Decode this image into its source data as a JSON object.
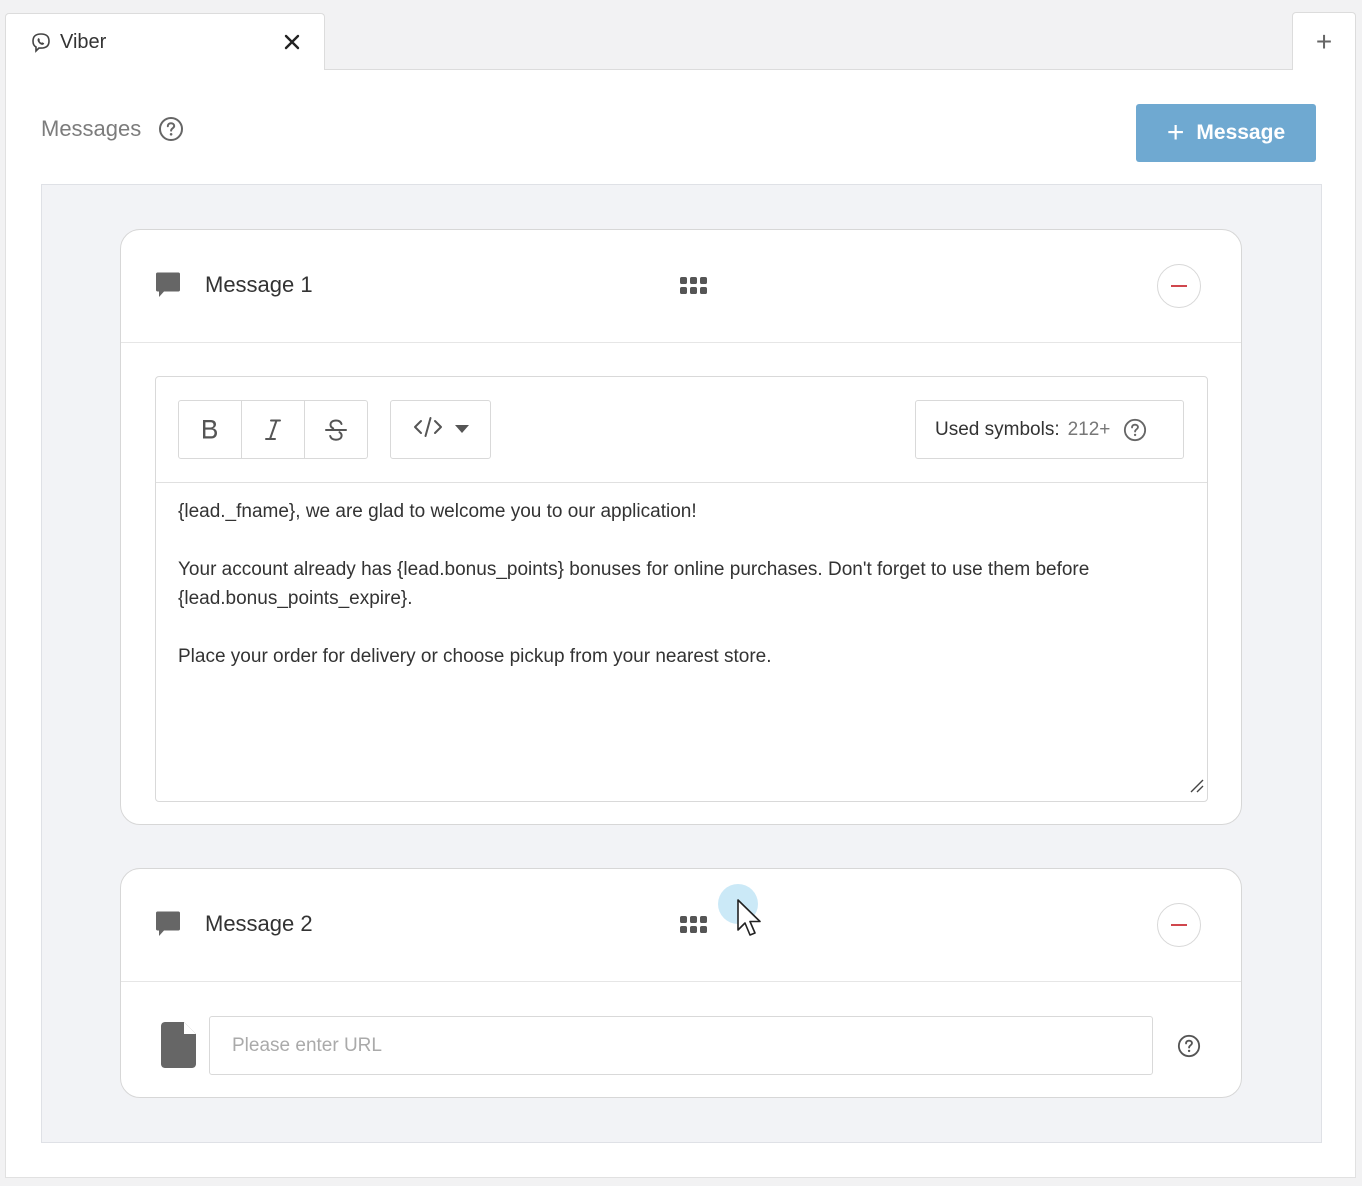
{
  "tab": {
    "title": "Viber",
    "icon": "viber-icon",
    "close_icon": "close-icon"
  },
  "add_tab": {
    "label": "+"
  },
  "section": {
    "title": "Messages",
    "help_icon": "help-circle-icon"
  },
  "add_message_button": {
    "plus": "+",
    "label": "Message"
  },
  "messages": [
    {
      "title": "Message 1",
      "icon": "chat-bubble-icon",
      "toolbar": {
        "bold_label": "B",
        "italic_label": "I",
        "strike_label": "S",
        "code_icon": "code-icon",
        "symbols_label": "Used symbols:",
        "symbols_count": "212+"
      },
      "text_lines": [
        "{lead._fname}, we are glad to welcome you to our application!",
        "Your account already has {lead.bonus_points} bonuses for online purchases. Don't forget to use them before {lead.bonus_points_expire}.",
        "Place your order for delivery or choose pickup from your nearest store."
      ]
    },
    {
      "title": "Message 2",
      "icon": "chat-bubble-icon",
      "url_placeholder": "Please enter URL",
      "url_value": ""
    }
  ],
  "colors": {
    "accent_button": "#6fa9d1",
    "remove_red": "#d0474d",
    "area_bg": "#f2f3f6"
  }
}
